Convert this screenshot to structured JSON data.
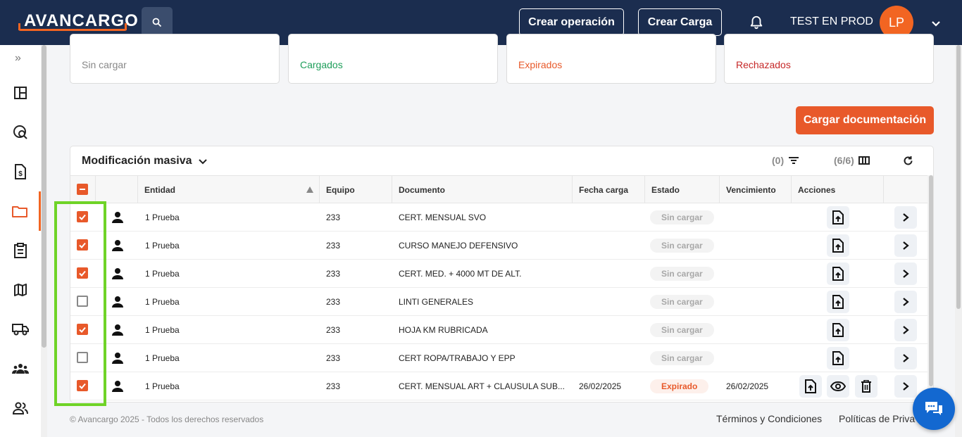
{
  "header": {
    "logo": "AVANCARGO",
    "crear_operacion": "Crear operación",
    "crear_carga": "Crear Carga",
    "user_name": "TEST EN PROD",
    "avatar_initials": "LP"
  },
  "stats": [
    {
      "label": "Sin cargar",
      "color": "#888888"
    },
    {
      "label": "Cargados",
      "color": "#1e9e5a"
    },
    {
      "label": "Expirados",
      "color": "#e8592a"
    },
    {
      "label": "Rechazados",
      "color": "#c62828"
    }
  ],
  "cargar_btn": "Cargar documentación",
  "table": {
    "title": "Modificación masiva",
    "filter_count": "(0)",
    "columns_count": "(6/6)",
    "headers": {
      "entidad": "Entidad",
      "equipo": "Equipo",
      "documento": "Documento",
      "fecha_carga": "Fecha carga",
      "estado": "Estado",
      "vencimiento": "Vencimiento",
      "acciones": "Acciones"
    },
    "rows": [
      {
        "checked": true,
        "entidad": "1 Prueba",
        "equipo": "233",
        "documento": "CERT. MENSUAL SVO",
        "fecha_carga": "",
        "estado": "Sin cargar",
        "vencimiento": ""
      },
      {
        "checked": true,
        "entidad": "1 Prueba",
        "equipo": "233",
        "documento": "CURSO MANEJO DEFENSIVO",
        "fecha_carga": "",
        "estado": "Sin cargar",
        "vencimiento": ""
      },
      {
        "checked": true,
        "entidad": "1 Prueba",
        "equipo": "233",
        "documento": "CERT. MED. + 4000 MT DE ALT.",
        "fecha_carga": "",
        "estado": "Sin cargar",
        "vencimiento": ""
      },
      {
        "checked": false,
        "entidad": "1 Prueba",
        "equipo": "233",
        "documento": "LINTI GENERALES",
        "fecha_carga": "",
        "estado": "Sin cargar",
        "vencimiento": ""
      },
      {
        "checked": true,
        "entidad": "1 Prueba",
        "equipo": "233",
        "documento": "HOJA KM RUBRICADA",
        "fecha_carga": "",
        "estado": "Sin cargar",
        "vencimiento": ""
      },
      {
        "checked": false,
        "entidad": "1 Prueba",
        "equipo": "233",
        "documento": "CERT ROPA/TRABAJO Y EPP",
        "fecha_carga": "",
        "estado": "Sin cargar",
        "vencimiento": ""
      },
      {
        "checked": true,
        "entidad": "1 Prueba",
        "equipo": "233",
        "documento": "CERT. MENSUAL ART + CLAUSULA SUB...",
        "fecha_carga": "26/02/2025",
        "estado": "Expirado",
        "vencimiento": "26/02/2025"
      }
    ]
  },
  "footer": {
    "copyright": "© Avancargo 2025 - Todos los derechos reservados",
    "terminos": "Términos y Condiciones",
    "politicas": "Políticas de Priva"
  }
}
